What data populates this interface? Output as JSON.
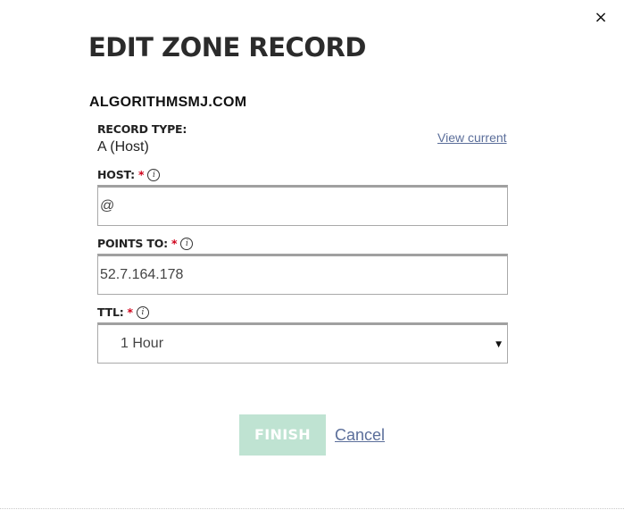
{
  "dialog": {
    "title": "EDIT ZONE RECORD",
    "close_label": "×",
    "domain": "ALGORITHMSMJ.COM"
  },
  "record_type": {
    "label": "RECORD TYPE:",
    "value": "A (Host)",
    "view_current_label": "View current"
  },
  "host": {
    "label": "HOST:",
    "required_mark": "*",
    "info_icon": "i",
    "value": "@"
  },
  "points_to": {
    "label": "POINTS TO:",
    "required_mark": "*",
    "info_icon": "i",
    "value": "52.7.164.178"
  },
  "ttl": {
    "label": "TTL:",
    "required_mark": "*",
    "info_icon": "i",
    "selected": "1 Hour",
    "caret": "▼"
  },
  "actions": {
    "finish_label": "FINISH",
    "cancel_label": "Cancel"
  },
  "colors": {
    "finish_button_bg": "#bfe3d2",
    "link": "#5b6e9a",
    "required": "#d0021b"
  }
}
